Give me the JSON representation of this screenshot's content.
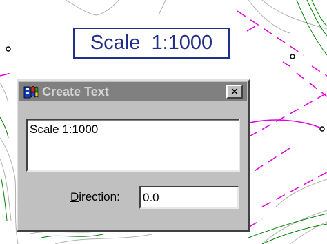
{
  "canvas": {
    "scale_text": "Scale  1:1000"
  },
  "dialog": {
    "title": "Create Text",
    "close_label": "✕",
    "text_value": "Scale 1:1000",
    "direction_label_mnemonic": "D",
    "direction_label_rest": "irection:",
    "direction_value": "0.0"
  },
  "colors": {
    "contour": "#a8a8a8",
    "magenta": "#e000e0",
    "green": "#008000",
    "label_blue": "#1f2f8a"
  }
}
